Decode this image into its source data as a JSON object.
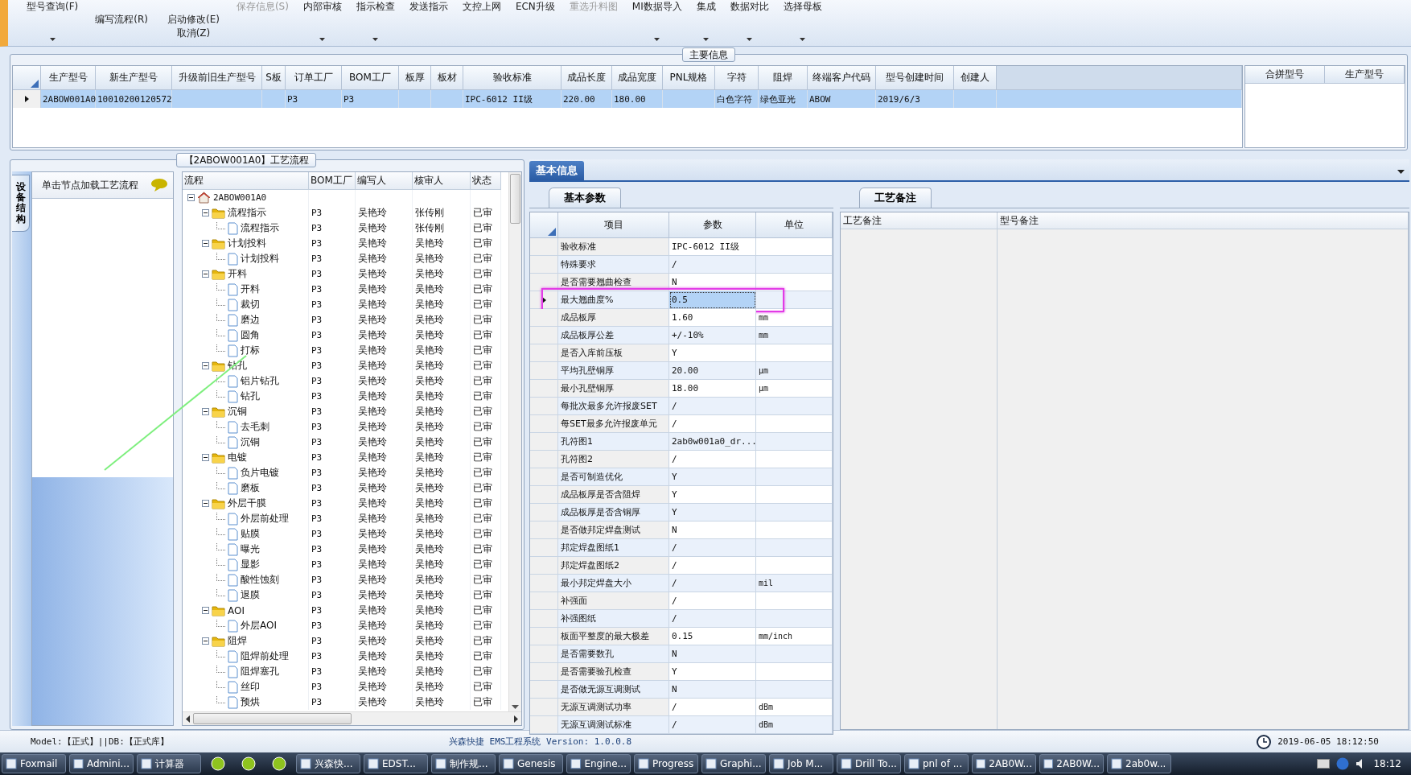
{
  "toolbar": [
    {
      "kind": "large",
      "items": [
        {
          "label": "型号查询(F)",
          "dropdown": true,
          "disabled": false
        }
      ]
    },
    {
      "kind": "small",
      "items": [
        {
          "label": "编写流程(R)",
          "dropdown": false,
          "disabled": false
        }
      ]
    },
    {
      "kind": "small",
      "items": [
        {
          "label": "启动修改(E)",
          "dropdown": false,
          "disabled": false
        },
        {
          "label": "取消(Z)",
          "dropdown": false,
          "disabled": false
        }
      ]
    },
    {
      "kind": "large",
      "items": [
        {
          "label": "保存信息(S)",
          "dropdown": false,
          "disabled": true
        }
      ]
    },
    {
      "kind": "large",
      "items": [
        {
          "label": "内部审核",
          "dropdown": true,
          "disabled": false
        }
      ]
    },
    {
      "kind": "large",
      "items": [
        {
          "label": "指示检查",
          "dropdown": true,
          "disabled": false
        }
      ]
    },
    {
      "kind": "large",
      "items": [
        {
          "label": "发送指示",
          "dropdown": false,
          "disabled": false
        }
      ]
    },
    {
      "kind": "large",
      "items": [
        {
          "label": "文控上网",
          "dropdown": false,
          "disabled": false
        }
      ]
    },
    {
      "kind": "large",
      "items": [
        {
          "label": "ECN升级",
          "dropdown": false,
          "disabled": false
        }
      ]
    },
    {
      "kind": "large",
      "items": [
        {
          "label": "重选升料图",
          "dropdown": false,
          "disabled": true
        }
      ]
    },
    {
      "kind": "large",
      "items": [
        {
          "label": "MI数据导入",
          "dropdown": true,
          "disabled": false
        }
      ]
    },
    {
      "kind": "large",
      "items": [
        {
          "label": "集成",
          "dropdown": true,
          "disabled": false
        }
      ]
    },
    {
      "kind": "large",
      "items": [
        {
          "label": "数据对比",
          "dropdown": true,
          "disabled": false
        }
      ]
    },
    {
      "kind": "large",
      "items": [
        {
          "label": "选择母板",
          "dropdown": true,
          "disabled": false
        }
      ]
    }
  ],
  "main_info": {
    "title": "主要信息",
    "row": {
      "selected": true
    },
    "columns": [
      {
        "header": "生产型号",
        "cell": "2ABOW001A0"
      },
      {
        "header": "新生产型号",
        "cell": "10010200120572"
      },
      {
        "header": "升级前旧生产型号"
      },
      {
        "header": "S板"
      },
      {
        "header": "订单工厂",
        "cell": "P3"
      },
      {
        "header": "BOM工厂",
        "cell": "P3"
      },
      {
        "header": "板厚"
      },
      {
        "header": "板材"
      },
      {
        "header": "验收标准",
        "cell": "IPC-6012 II级"
      },
      {
        "header": "成品长度",
        "cell": "220.00"
      },
      {
        "header": "成品宽度",
        "cell": "180.00"
      },
      {
        "header": "PNL规格"
      },
      {
        "header": "字符",
        "cell": "白色字符"
      },
      {
        "header": "阻焊",
        "cell": "绿色亚光"
      },
      {
        "header": "终端客户代码",
        "cell": "ABOW"
      },
      {
        "header": "型号创建时间",
        "cell": "2019/6/3"
      },
      {
        "header": "创建人"
      }
    ],
    "merge_table": {
      "columns": [
        "合拼型号",
        "生产型号"
      ]
    }
  },
  "left_panel": {
    "vertical_tab": "设备结构",
    "header": "单击节点加载工艺流程"
  },
  "process_tree": {
    "title": "【2ABOW001A0】工艺流程",
    "columns": [
      "流程",
      "BOM工厂",
      "编写人",
      "核审人",
      "状态"
    ],
    "root": {
      "label": "2ABOW001A0",
      "expanded": true,
      "children": [
        {
          "label": "流程指示",
          "bom_factory": "P3",
          "author": "吴艳玲",
          "reviewer": "张传刚",
          "status": "已审",
          "expanded": true,
          "children": [
            {
              "label": "流程指示",
              "bom_factory": "P3",
              "author": "吴艳玲",
              "reviewer": "张传刚",
              "status": "已审"
            }
          ]
        },
        {
          "label": "计划投料",
          "bom_factory": "P3",
          "author": "吴艳玲",
          "reviewer": "吴艳玲",
          "status": "已审",
          "expanded": true,
          "children": [
            {
              "label": "计划投料",
              "bom_factory": "P3",
              "author": "吴艳玲",
              "reviewer": "吴艳玲",
              "status": "已审"
            }
          ]
        },
        {
          "label": "开料",
          "bom_factory": "P3",
          "author": "吴艳玲",
          "reviewer": "吴艳玲",
          "status": "已审",
          "expanded": true,
          "children": [
            {
              "label": "开料",
              "bom_factory": "P3",
              "author": "吴艳玲",
              "reviewer": "吴艳玲",
              "status": "已审"
            },
            {
              "label": "裁切",
              "bom_factory": "P3",
              "author": "吴艳玲",
              "reviewer": "吴艳玲",
              "status": "已审"
            },
            {
              "label": "磨边",
              "bom_factory": "P3",
              "author": "吴艳玲",
              "reviewer": "吴艳玲",
              "status": "已审"
            },
            {
              "label": "圆角",
              "bom_factory": "P3",
              "author": "吴艳玲",
              "reviewer": "吴艳玲",
              "status": "已审"
            },
            {
              "label": "打标",
              "bom_factory": "P3",
              "author": "吴艳玲",
              "reviewer": "吴艳玲",
              "status": "已审"
            }
          ]
        },
        {
          "label": "钻孔",
          "bom_factory": "P3",
          "author": "吴艳玲",
          "reviewer": "吴艳玲",
          "status": "已审",
          "expanded": true,
          "children": [
            {
              "label": "铝片钻孔",
              "bom_factory": "P3",
              "author": "吴艳玲",
              "reviewer": "吴艳玲",
              "status": "已审"
            },
            {
              "label": "钻孔",
              "bom_factory": "P3",
              "author": "吴艳玲",
              "reviewer": "吴艳玲",
              "status": "已审"
            }
          ]
        },
        {
          "label": "沉铜",
          "bom_factory": "P3",
          "author": "吴艳玲",
          "reviewer": "吴艳玲",
          "status": "已审",
          "expanded": true,
          "children": [
            {
              "label": "去毛刺",
              "bom_factory": "P3",
              "author": "吴艳玲",
              "reviewer": "吴艳玲",
              "status": "已审"
            },
            {
              "label": "沉铜",
              "bom_factory": "P3",
              "author": "吴艳玲",
              "reviewer": "吴艳玲",
              "status": "已审"
            }
          ]
        },
        {
          "label": "电镀",
          "bom_factory": "P3",
          "author": "吴艳玲",
          "reviewer": "吴艳玲",
          "status": "已审",
          "expanded": true,
          "children": [
            {
              "label": "负片电镀",
              "bom_factory": "P3",
              "author": "吴艳玲",
              "reviewer": "吴艳玲",
              "status": "已审"
            },
            {
              "label": "磨板",
              "bom_factory": "P3",
              "author": "吴艳玲",
              "reviewer": "吴艳玲",
              "status": "已审"
            }
          ]
        },
        {
          "label": "外层干膜",
          "bom_factory": "P3",
          "author": "吴艳玲",
          "reviewer": "吴艳玲",
          "status": "已审",
          "expanded": true,
          "children": [
            {
              "label": "外层前处理",
              "bom_factory": "P3",
              "author": "吴艳玲",
              "reviewer": "吴艳玲",
              "status": "已审"
            },
            {
              "label": "贴膜",
              "bom_factory": "P3",
              "author": "吴艳玲",
              "reviewer": "吴艳玲",
              "status": "已审"
            },
            {
              "label": "曝光",
              "bom_factory": "P3",
              "author": "吴艳玲",
              "reviewer": "吴艳玲",
              "status": "已审"
            },
            {
              "label": "显影",
              "bom_factory": "P3",
              "author": "吴艳玲",
              "reviewer": "吴艳玲",
              "status": "已审"
            },
            {
              "label": "酸性蚀刻",
              "bom_factory": "P3",
              "author": "吴艳玲",
              "reviewer": "吴艳玲",
              "status": "已审"
            },
            {
              "label": "退膜",
              "bom_factory": "P3",
              "author": "吴艳玲",
              "reviewer": "吴艳玲",
              "status": "已审"
            }
          ]
        },
        {
          "label": "AOI",
          "bom_factory": "P3",
          "author": "吴艳玲",
          "reviewer": "吴艳玲",
          "status": "已审",
          "expanded": true,
          "children": [
            {
              "label": "外层AOI",
              "bom_factory": "P3",
              "author": "吴艳玲",
              "reviewer": "吴艳玲",
              "status": "已审"
            }
          ]
        },
        {
          "label": "阻焊",
          "bom_factory": "P3",
          "author": "吴艳玲",
          "reviewer": "吴艳玲",
          "status": "已审",
          "expanded": true,
          "children": [
            {
              "label": "阻焊前处理",
              "bom_factory": "P3",
              "author": "吴艳玲",
              "reviewer": "吴艳玲",
              "status": "已审"
            },
            {
              "label": "阻焊塞孔",
              "bom_factory": "P3",
              "author": "吴艳玲",
              "reviewer": "吴艳玲",
              "status": "已审"
            },
            {
              "label": "丝印",
              "bom_factory": "P3",
              "author": "吴艳玲",
              "reviewer": "吴艳玲",
              "status": "已审"
            },
            {
              "label": "预烘",
              "bom_factory": "P3",
              "author": "吴艳玲",
              "reviewer": "吴艳玲",
              "status": "已审"
            }
          ]
        }
      ]
    }
  },
  "basic_info": {
    "tab": "基本信息",
    "params": {
      "tab": "基本参数",
      "columns": [
        "项目",
        "参数",
        "单位"
      ],
      "rows": [
        {
          "item": "验收标准",
          "value": "IPC-6012 II级",
          "selected": false
        },
        {
          "item": "特殊要求",
          "value": "/",
          "selected": false
        },
        {
          "item": "是否需要翘曲检查",
          "value": "N",
          "selected": false
        },
        {
          "item": "最大翘曲度%",
          "value": "0.5",
          "selected": true
        },
        {
          "item": "成品板厚",
          "value": "1.60",
          "unit": "mm",
          "selected": false
        },
        {
          "item": "成品板厚公差",
          "value": "+/-10%",
          "unit": "mm",
          "selected": false
        },
        {
          "item": "是否入库前压板",
          "value": "Y",
          "selected": false
        },
        {
          "item": "平均孔壁铜厚",
          "value": "20.00",
          "unit": "μm",
          "selected": false
        },
        {
          "item": "最小孔壁铜厚",
          "value": "18.00",
          "unit": "μm",
          "selected": false
        },
        {
          "item": "每批次最多允许报废SET",
          "value": "/",
          "selected": false
        },
        {
          "item": "每SET最多允许报废单元",
          "value": "/",
          "selected": false
        },
        {
          "item": "孔符图1",
          "value": "2ab0w001a0_dr...",
          "selected": false
        },
        {
          "item": "孔符图2",
          "value": "/",
          "selected": false
        },
        {
          "item": "是否可制造优化",
          "value": "Y",
          "selected": false
        },
        {
          "item": "成品板厚是否含阻焊",
          "value": "Y",
          "selected": false
        },
        {
          "item": "成品板厚是否含铜厚",
          "value": "Y",
          "selected": false
        },
        {
          "item": "是否做邦定焊盘测试",
          "value": "N",
          "selected": false
        },
        {
          "item": "邦定焊盘图纸1",
          "value": "/",
          "selected": false
        },
        {
          "item": "邦定焊盘图纸2",
          "value": "/",
          "selected": false
        },
        {
          "item": "最小邦定焊盘大小",
          "value": "/",
          "unit": "mil",
          "selected": false
        },
        {
          "item": "补强面",
          "value": "/",
          "selected": false
        },
        {
          "item": "补强图纸",
          "value": "/",
          "selected": false
        },
        {
          "item": "板面平整度的最大极差",
          "value": "0.15",
          "unit": "mm/inch",
          "selected": false
        },
        {
          "item": "是否需要数孔",
          "value": "N",
          "selected": false
        },
        {
          "item": "是否需要验孔检查",
          "value": "Y",
          "selected": false
        },
        {
          "item": "是否做无源互调测试",
          "value": "N",
          "selected": false
        },
        {
          "item": "无源互调测试功率",
          "value": "/",
          "unit": "dBm",
          "selected": false
        },
        {
          "item": "无源互调测试标准",
          "value": "/",
          "unit": "dBm",
          "selected": false
        }
      ]
    },
    "notes": {
      "tab": "工艺备注",
      "columns": [
        "工艺备注",
        "型号备注"
      ]
    }
  },
  "status_bar": {
    "left": "Model:【正式】||DB:【正式库】",
    "center": "兴森快捷 EMS工程系统 Version: 1.0.0.8",
    "datetime": "2019-06-05 18:12:50"
  },
  "taskbar": {
    "items": [
      {
        "kind": "app",
        "label": "Foxmail"
      },
      {
        "kind": "app",
        "label": "Admini..."
      },
      {
        "kind": "app",
        "label": "计算器"
      },
      {
        "kind": "icon"
      },
      {
        "kind": "icon"
      },
      {
        "kind": "icon"
      },
      {
        "kind": "app",
        "label": "兴森快..."
      },
      {
        "kind": "app",
        "label": "EDST..."
      },
      {
        "kind": "app",
        "label": "制作规..."
      },
      {
        "kind": "app",
        "label": "Genesis"
      },
      {
        "kind": "app",
        "label": "Engine..."
      },
      {
        "kind": "app",
        "label": "Progress"
      },
      {
        "kind": "app",
        "label": "Graphi..."
      },
      {
        "kind": "app",
        "label": "Job M..."
      },
      {
        "kind": "app",
        "label": "Drill To..."
      },
      {
        "kind": "app",
        "label": "pnl of ..."
      },
      {
        "kind": "app",
        "label": "2AB0W..."
      },
      {
        "kind": "app",
        "label": "2AB0W..."
      },
      {
        "kind": "app",
        "label": "2ab0w..."
      }
    ],
    "clock": "18:12"
  }
}
